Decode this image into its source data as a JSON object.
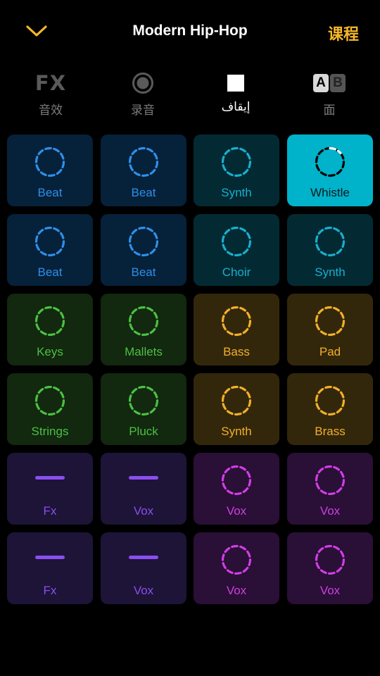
{
  "header": {
    "title": "Modern Hip-Hop",
    "course_label": "课程"
  },
  "toolbar": [
    {
      "id": "fx",
      "icon_text": "FX",
      "label": "音效",
      "icon": "fx-icon"
    },
    {
      "id": "record",
      "label": "录音",
      "icon": "record-icon"
    },
    {
      "id": "stop",
      "label": "إيقاف",
      "icon": "stop-icon"
    },
    {
      "id": "ab",
      "label": "面",
      "icon": "ab-icon",
      "icon_a": "A",
      "icon_b": "B"
    }
  ],
  "pads": [
    [
      {
        "label": "Beat",
        "kind": "ring",
        "color": "#2f8fe8",
        "bg": "#06213a"
      },
      {
        "label": "Beat",
        "kind": "ring",
        "color": "#2f8fe8",
        "bg": "#06213a"
      },
      {
        "label": "Synth",
        "kind": "ring",
        "color": "#1aaecc",
        "bg": "#032a33"
      },
      {
        "label": "Whistle",
        "kind": "active",
        "color": "#000000",
        "bg": "#00b2ca",
        "text": "#0a1a1d"
      }
    ],
    [
      {
        "label": "Beat",
        "kind": "ring",
        "color": "#2f8fe8",
        "bg": "#06213a"
      },
      {
        "label": "Beat",
        "kind": "ring",
        "color": "#2f8fe8",
        "bg": "#06213a"
      },
      {
        "label": "Choir",
        "kind": "ring",
        "color": "#1aaecc",
        "bg": "#032a33"
      },
      {
        "label": "Synth",
        "kind": "ring",
        "color": "#1aaecc",
        "bg": "#032a33"
      }
    ],
    [
      {
        "label": "Keys",
        "kind": "ring",
        "color": "#4cc043",
        "bg": "#12280f"
      },
      {
        "label": "Mallets",
        "kind": "ring",
        "color": "#4cc043",
        "bg": "#12280f"
      },
      {
        "label": "Bass",
        "kind": "ring",
        "color": "#f1b02a",
        "bg": "#33270b"
      },
      {
        "label": "Pad",
        "kind": "ring",
        "color": "#f1b02a",
        "bg": "#33270b"
      }
    ],
    [
      {
        "label": "Strings",
        "kind": "ring",
        "color": "#4cc043",
        "bg": "#12280f"
      },
      {
        "label": "Pluck",
        "kind": "ring",
        "color": "#4cc043",
        "bg": "#12280f"
      },
      {
        "label": "Synth",
        "kind": "ring",
        "color": "#f1b02a",
        "bg": "#33270b"
      },
      {
        "label": "Brass",
        "kind": "ring",
        "color": "#f1b02a",
        "bg": "#33270b"
      }
    ],
    [
      {
        "label": "Fx",
        "kind": "dash",
        "color": "#8b4ef0",
        "bg": "#1d1438"
      },
      {
        "label": "Vox",
        "kind": "dash",
        "color": "#8b4ef0",
        "bg": "#1d1438"
      },
      {
        "label": "Vox",
        "kind": "ring",
        "color": "#d03ee6",
        "bg": "#2a0f36"
      },
      {
        "label": "Vox",
        "kind": "ring",
        "color": "#d03ee6",
        "bg": "#2a0f36"
      }
    ],
    [
      {
        "label": "Fx",
        "kind": "dash",
        "color": "#8b4ef0",
        "bg": "#1d1438"
      },
      {
        "label": "Vox",
        "kind": "dash",
        "color": "#8b4ef0",
        "bg": "#1d1438"
      },
      {
        "label": "Vox",
        "kind": "ring",
        "color": "#d03ee6",
        "bg": "#2a0f36"
      },
      {
        "label": "Vox",
        "kind": "ring",
        "color": "#d03ee6",
        "bg": "#2a0f36"
      }
    ]
  ],
  "colors": {
    "accent": "#f5b829"
  }
}
